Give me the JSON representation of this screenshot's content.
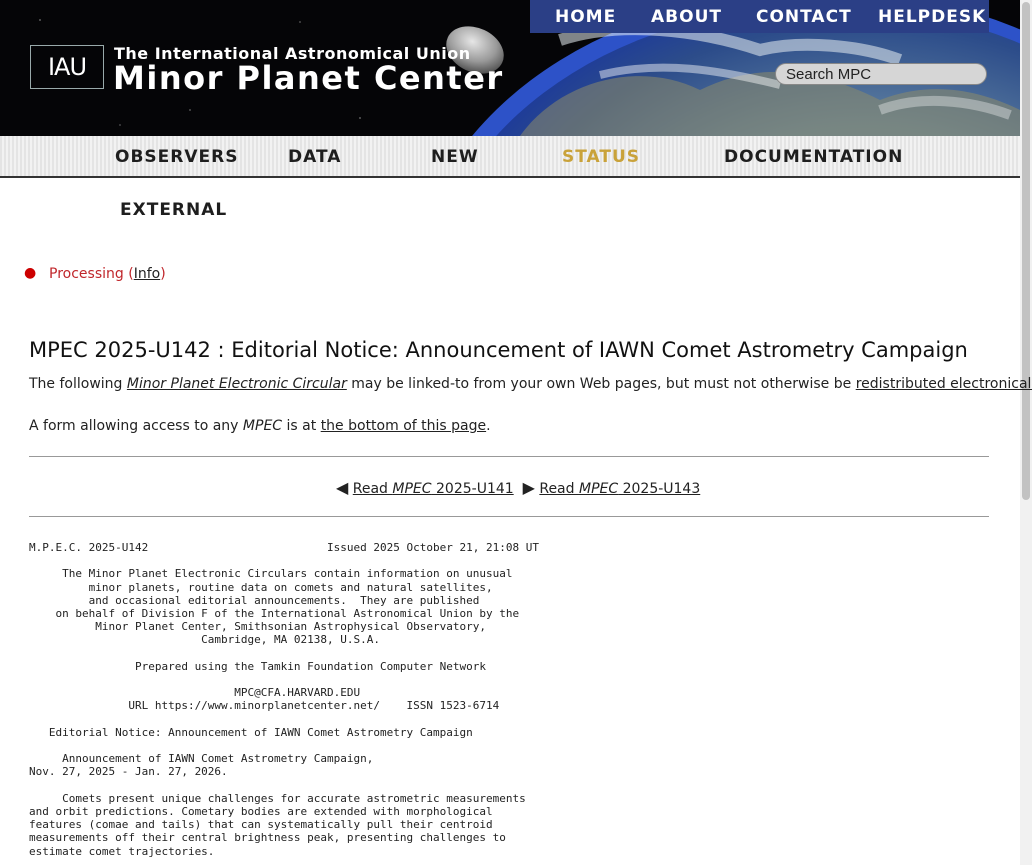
{
  "header": {
    "logo_text": "IAU",
    "subtitle": "The International Astronomical Union",
    "title": "Minor Planet Center",
    "top_nav": [
      "HOME",
      "ABOUT",
      "CONTACT",
      "HELPDESK"
    ],
    "search_placeholder": "Search MPC"
  },
  "main_nav": {
    "items": [
      "OBSERVERS",
      "DATA",
      "NEW",
      "STATUS",
      "DOCUMENTATION",
      "EXTERNAL"
    ],
    "active": "STATUS"
  },
  "status": {
    "label": "Processing",
    "info_open": "(",
    "info_link": "Info",
    "info_close": ")"
  },
  "mpec": {
    "heading": "MPEC 2025-U142 : Editorial Notice: Announcement of IAWN Comet Astrometry Campaign",
    "intro_prefix": "The following ",
    "intro_link": "Minor Planet Electronic Circular",
    "intro_middle": " may be linked-to from your own Web pages, but must not otherwise be ",
    "intro_link2": "redistributed electronically",
    "intro_suffix": ".",
    "form_prefix": "A form allowing access to any ",
    "form_em": "MPEC",
    "form_middle": " is at ",
    "form_link": "the bottom of this page",
    "form_suffix": ".",
    "prev_read": "Read ",
    "prev_em": "MPEC",
    "prev_num": " 2025-U141",
    "next_read": "Read ",
    "next_em": "MPEC",
    "next_num": " 2025-U143",
    "circular_text": "M.P.E.C. 2025-U142                           Issued 2025 October 21, 21:08 UT\n\n     The Minor Planet Electronic Circulars contain information on unusual\n         minor planets, routine data on comets and natural satellites,\n         and occasional editorial announcements.  They are published\n    on behalf of Division F of the International Astronomical Union by the\n          Minor Planet Center, Smithsonian Astrophysical Observatory,\n                          Cambridge, MA 02138, U.S.A.\n\n                Prepared using the Tamkin Foundation Computer Network\n\n                               MPC@CFA.HARVARD.EDU\n               URL https://www.minorplanetcenter.net/    ISSN 1523-6714\n\n   Editorial Notice: Announcement of IAWN Comet Astrometry Campaign\n\n     Announcement of IAWN Comet Astrometry Campaign,\nNov. 27, 2025 - Jan. 27, 2026.\n\n     Comets present unique challenges for accurate astrometric measurements\nand orbit predictions. Cometary bodies are extended with morphological\nfeatures (comae and tails) that can systematically pull their centroid\nmeasurements off their central brightness peak, presenting challenges to\nestimate comet trajectories."
  }
}
